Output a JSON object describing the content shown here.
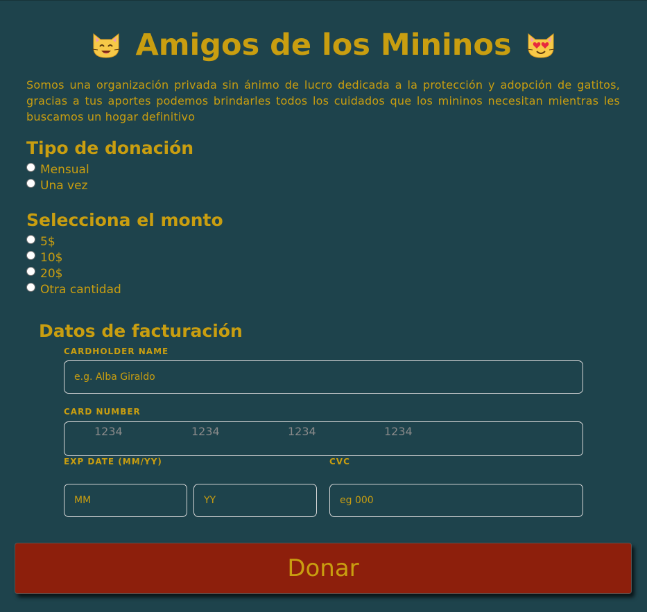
{
  "header": {
    "title": "Amigos de los Mininos",
    "left_icon": "smiling-cat-icon",
    "right_icon": "heart-eyes-cat-icon"
  },
  "intro": "Somos una organización privada sin ánimo de lucro dedicada a la protección y adopción de gatitos, gracias a tus aportes podemos brindarles todos los cuidados que los mininos necesitan mientras les buscamos un hogar definitivo",
  "donation_type": {
    "title": "Tipo de donación",
    "options": [
      "Mensual",
      "Una vez"
    ]
  },
  "amount": {
    "title": "Selecciona el monto",
    "options": [
      "5$",
      "10$",
      "20$",
      "Otra cantidad"
    ]
  },
  "billing": {
    "title": "Datos de facturación",
    "cardholder_label": "CARDHOLDER NAME",
    "cardholder_placeholder": "e.g. Alba Giraldo",
    "card_number_label": "CARD NUMBER",
    "card_number_placeholders": [
      "1234",
      "1234",
      "1234",
      "1234"
    ],
    "exp_label": "EXP DATE (MM/YY)",
    "exp_month_placeholder": "MM",
    "exp_year_placeholder": "YY",
    "cvc_label": "CVC",
    "cvc_placeholder": "eg 000"
  },
  "donate_button": "Donar",
  "colors": {
    "background": "#1e434c",
    "accent": "#c99e10",
    "button": "#8d1f0c"
  }
}
